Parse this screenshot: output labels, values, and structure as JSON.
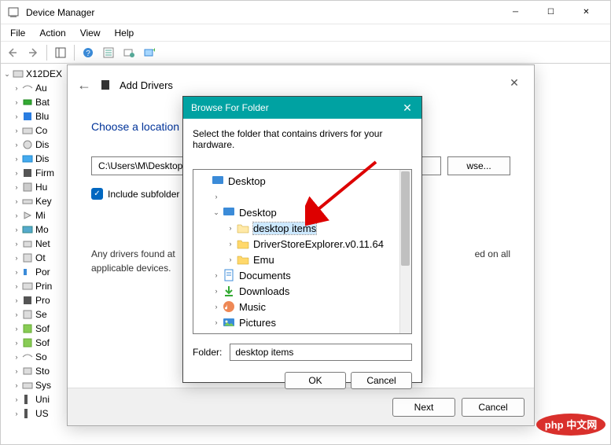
{
  "window": {
    "title": "Device Manager",
    "menu": [
      "File",
      "Action",
      "View",
      "Help"
    ]
  },
  "tree": {
    "root": "X12DEX",
    "items": [
      "Au",
      "Bat",
      "Blu",
      "Co",
      "Dis",
      "Dis",
      "Firm",
      "Hu",
      "Key",
      "Mi",
      "Mo",
      "Net",
      "Ot",
      "Por",
      "Prin",
      "Pro",
      "Se",
      "Sof",
      "Sof",
      "So",
      "Sto",
      "Sys",
      "Uni",
      "US"
    ]
  },
  "addDrivers": {
    "title": "Add Drivers",
    "heading": "Choose a location",
    "path": "C:\\Users\\M\\Desktop",
    "browse": "wse...",
    "includeSubfolders": "Include subfolder",
    "info": "Any drivers found at ... ed on all applicable devices.",
    "info1": "Any drivers found at",
    "info2": "ed on all",
    "info3": "applicable devices.",
    "next": "Next",
    "cancel": "Cancel"
  },
  "browseFolder": {
    "title": "Browse For Folder",
    "instruction": "Select the folder that contains drivers for your hardware.",
    "rootDesktop": "Desktop",
    "desktop": "Desktop",
    "items": {
      "desktopItems": "desktop items",
      "driverStore": "DriverStoreExplorer.v0.11.64",
      "emu": "Emu"
    },
    "documents": "Documents",
    "downloads": "Downloads",
    "music": "Music",
    "pictures": "Pictures",
    "folderLabel": "Folder:",
    "folderValue": "desktop items",
    "ok": "OK",
    "cancel": "Cancel"
  },
  "watermark": "php 中文网"
}
